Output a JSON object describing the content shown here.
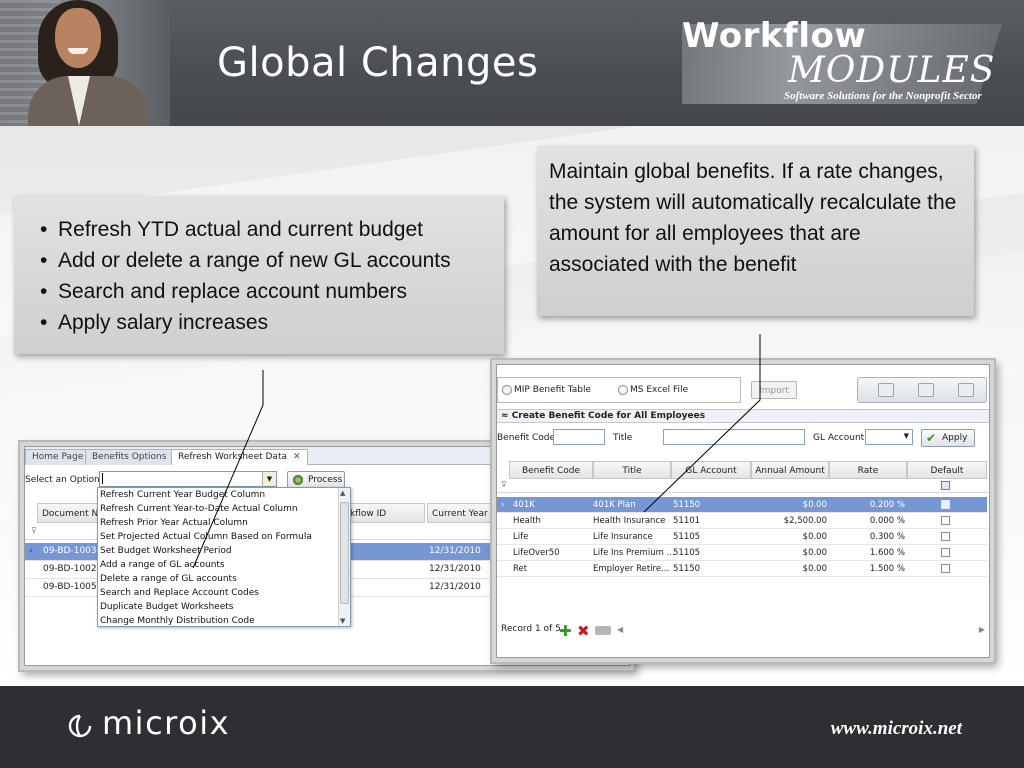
{
  "slide": {
    "title": "Global Changes",
    "logo": {
      "line1": "Workflow",
      "line2": "MODULES",
      "tagline": "Software Solutions for the Nonprofit Sector"
    }
  },
  "left_callout": {
    "bullets": [
      "Refresh YTD actual and current budget",
      "Add or delete a range of new GL accounts",
      "Search and replace account numbers",
      "Apply salary increases"
    ]
  },
  "right_callout": {
    "text": "Maintain global benefits. If a rate changes, the system will automatically recalculate the amount for all employees that are associated with the benefit"
  },
  "left_window": {
    "tabs": [
      "Home Page",
      "Benefits Options",
      "Refresh Worksheet Data"
    ],
    "tab_close": "✕",
    "select_label": "Select an Option",
    "process_label": "Process",
    "columns": [
      "Document No",
      "kflow ID",
      "Current Year"
    ],
    "rows": [
      {
        "doc": "09-BD-1003",
        "year": "12/31/2010"
      },
      {
        "doc": "09-BD-1002",
        "year": "12/31/2010"
      },
      {
        "doc": "09-BD-1005",
        "year": "12/31/2010"
      }
    ],
    "options": [
      "Refresh Current Year Budget Column",
      "Refresh Current Year-to-Date Actual Column",
      "Refresh Prior Year Actual Column",
      "Set Projected Actual Column Based on Formula",
      "Set Budget Worksheet Period",
      "Add a range of GL accounts",
      "Delete a range of GL accounts",
      "Search and Replace Account Codes",
      "Duplicate Budget Worksheets",
      "Change Monthly Distribution Code"
    ]
  },
  "right_window": {
    "radio_1": "MIP Benefit Table",
    "radio_2": "MS Excel File",
    "import_label": "Import",
    "section_title": "Create Benefit Code for All Employees",
    "benefit_code_label": "Benefit Code",
    "title_label": "Title",
    "gl_account_label": "GL Account",
    "apply_label": "Apply",
    "columns": [
      "Benefit Code",
      "Title",
      "GL Account",
      "Annual Amount",
      "Rate",
      "Default"
    ],
    "rows": [
      {
        "code": "401K",
        "title": "401K Plan",
        "gl": "51150",
        "amount": "$0.00",
        "rate": "0.200 %"
      },
      {
        "code": "Health",
        "title": "Health Insurance",
        "gl": "51101",
        "amount": "$2,500.00",
        "rate": "0.000 %"
      },
      {
        "code": "Life",
        "title": "Life Insurance",
        "gl": "51105",
        "amount": "$0.00",
        "rate": "0.300 %"
      },
      {
        "code": "LifeOver50",
        "title": "Life Ins Premium ...",
        "gl": "51105",
        "amount": "$0.00",
        "rate": "1.600 %"
      },
      {
        "code": "Ret",
        "title": "Employer Retire...",
        "gl": "51150",
        "amount": "$0.00",
        "rate": "1.500 %"
      }
    ],
    "record_status": "Record 1 of 5"
  },
  "footer": {
    "brand": "microix",
    "url": "www.microix.net"
  },
  "colors": {
    "header_bg": "#4f5257",
    "footer_bg": "#2d2f32",
    "callout_bg": "#d9d9d9",
    "selection": "#7597d5"
  },
  "icons": [
    "add-icon",
    "delete-icon",
    "edit-icon",
    "check-icon",
    "process-gear-icon",
    "save-icon",
    "print-icon"
  ]
}
